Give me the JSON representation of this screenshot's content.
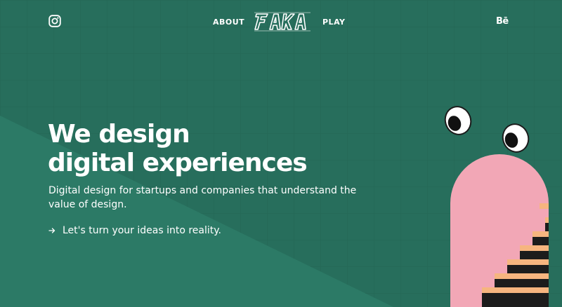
{
  "header": {
    "instagram_icon": "instagram-icon",
    "nav": {
      "about": "ABOUT",
      "play": "PLAY"
    },
    "logo_text": "FAKA",
    "behance_label": "Bē"
  },
  "hero": {
    "title_line1": "We design",
    "title_line2": "digital experiences",
    "subtitle": "Digital design for startups and companies that understand the value of design.",
    "cta_label": "Let's turn your ideas into reality."
  },
  "colors": {
    "background": "#276e5c",
    "background_light": "#2c7a66",
    "pink": "#f2a7b6",
    "stairs_orange": "#f6b57f",
    "stairs_dark": "#1c1c1c"
  }
}
